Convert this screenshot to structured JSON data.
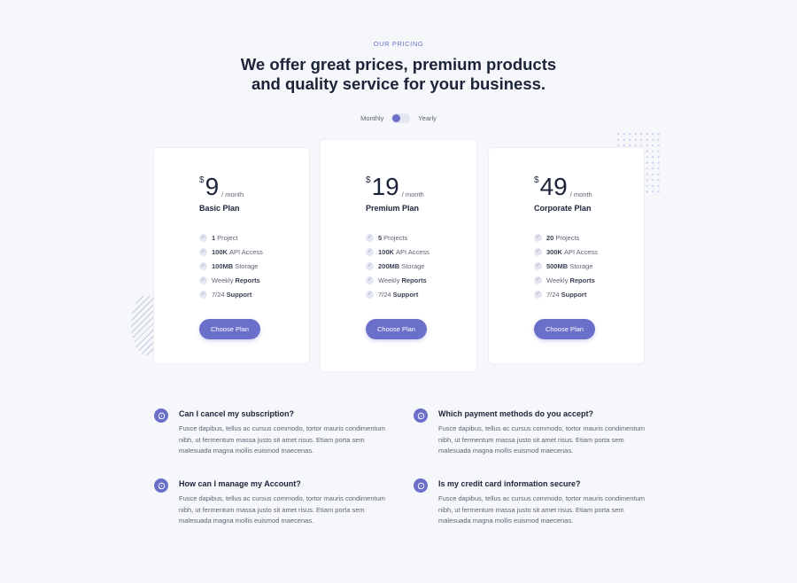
{
  "header": {
    "eyebrow": "OUR PRICING",
    "headline_line1": "We offer great prices, premium products",
    "headline_line2": "and quality service for your business."
  },
  "billing_toggle": {
    "left_label": "Monthly",
    "right_label": "Yearly",
    "selected": "Monthly"
  },
  "plans": [
    {
      "currency": "$",
      "price": "9",
      "period": "/ month",
      "name": "Basic Plan",
      "features": [
        {
          "bold": "1",
          "text": "Project"
        },
        {
          "bold": "100K",
          "text": "API Access"
        },
        {
          "bold": "100MB",
          "text": "Storage"
        },
        {
          "text": "Weekly",
          "bold": "Reports"
        },
        {
          "text": "7/24",
          "bold": "Support"
        }
      ],
      "button": "Choose Plan"
    },
    {
      "currency": "$",
      "price": "19",
      "period": "/ month",
      "name": "Premium Plan",
      "features": [
        {
          "bold": "5",
          "text": "Projects"
        },
        {
          "bold": "100K",
          "text": "API Access"
        },
        {
          "bold": "200MB",
          "text": "Storage"
        },
        {
          "text": "Weekly",
          "bold": "Reports"
        },
        {
          "text": "7/24",
          "bold": "Support"
        }
      ],
      "button": "Choose Plan"
    },
    {
      "currency": "$",
      "price": "49",
      "period": "/ month",
      "name": "Corporate Plan",
      "features": [
        {
          "bold": "20",
          "text": "Projects"
        },
        {
          "bold": "300K",
          "text": "API Access"
        },
        {
          "bold": "500MB",
          "text": "Storage"
        },
        {
          "text": "Weekly",
          "bold": "Reports"
        },
        {
          "text": "7/24",
          "bold": "Support"
        }
      ],
      "button": "Choose Plan"
    }
  ],
  "faq": [
    {
      "question": "Can I cancel my subscription?",
      "answer": "Fusce dapibus, tellus ac cursus commodo, tortor mauris condimentum nibh, ut fermentum massa justo sit amet risus. Etiam porta sem malesuada magna mollis euismod maecenas."
    },
    {
      "question": "Which payment methods do you accept?",
      "answer": "Fusce dapibus, tellus ac cursus commodo, tortor mauris condimentum nibh, ut fermentum massa justo sit amet risus. Etiam porta sem malesuada magna mollis euismod maecenas."
    },
    {
      "question": "How can I manage my Account?",
      "answer": "Fusce dapibus, tellus ac cursus commodo, tortor mauris condimentum nibh, ut fermentum massa justo sit amet risus. Etiam porta sem malesuada magna mollis euismod maecenas."
    },
    {
      "question": "Is my credit card information secure?",
      "answer": "Fusce dapibus, tellus ac cursus commodo, tortor mauris condimentum nibh, ut fermentum massa justo sit amet risus. Etiam porta sem malesuada magna mollis euismod maecenas."
    }
  ],
  "icons": {
    "check": "check-icon",
    "faq": "chat-bubble-icon"
  },
  "colors": {
    "accent": "#6a70c9",
    "background": "#f6f7fb",
    "heading": "#1b2438",
    "body_text": "#5d6474"
  }
}
